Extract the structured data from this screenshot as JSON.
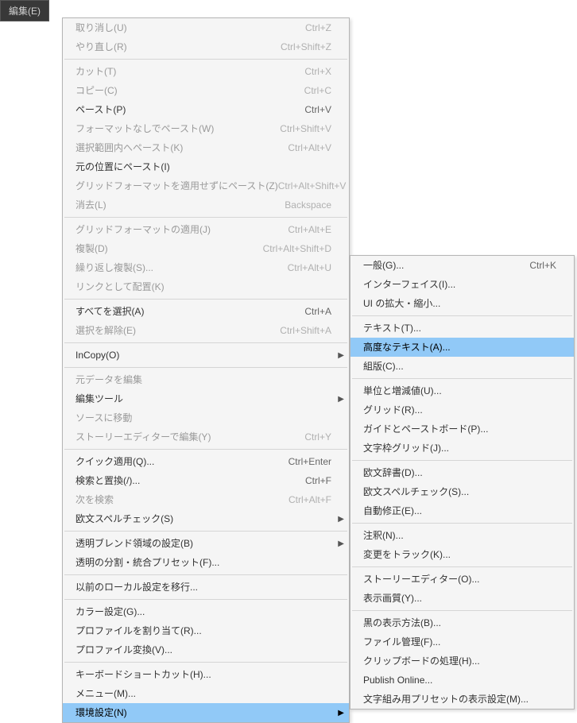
{
  "menu_tab": "編集(E)",
  "main_menu": [
    {
      "label": "取り消し(U)",
      "shortcut": "Ctrl+Z",
      "disabled": true
    },
    {
      "label": "やり直し(R)",
      "shortcut": "Ctrl+Shift+Z",
      "disabled": true
    },
    {
      "sep": true
    },
    {
      "label": "カット(T)",
      "shortcut": "Ctrl+X",
      "disabled": true
    },
    {
      "label": "コピー(C)",
      "shortcut": "Ctrl+C",
      "disabled": true
    },
    {
      "label": "ペースト(P)",
      "shortcut": "Ctrl+V"
    },
    {
      "label": "フォーマットなしでペースト(W)",
      "shortcut": "Ctrl+Shift+V",
      "disabled": true
    },
    {
      "label": "選択範囲内へペースト(K)",
      "shortcut": "Ctrl+Alt+V",
      "disabled": true
    },
    {
      "label": "元の位置にペースト(I)"
    },
    {
      "label": "グリッドフォーマットを適用せずにペースト(Z)",
      "shortcut": "Ctrl+Alt+Shift+V",
      "disabled": true
    },
    {
      "label": "消去(L)",
      "shortcut": "Backspace",
      "disabled": true
    },
    {
      "sep": true
    },
    {
      "label": "グリッドフォーマットの適用(J)",
      "shortcut": "Ctrl+Alt+E",
      "disabled": true
    },
    {
      "label": "複製(D)",
      "shortcut": "Ctrl+Alt+Shift+D",
      "disabled": true
    },
    {
      "label": "繰り返し複製(S)...",
      "shortcut": "Ctrl+Alt+U",
      "disabled": true
    },
    {
      "label": "リンクとして配置(K)",
      "disabled": true
    },
    {
      "sep": true
    },
    {
      "label": "すべてを選択(A)",
      "shortcut": "Ctrl+A"
    },
    {
      "label": "選択を解除(E)",
      "shortcut": "Ctrl+Shift+A",
      "disabled": true
    },
    {
      "sep": true
    },
    {
      "label": "InCopy(O)",
      "submenu": true
    },
    {
      "sep": true
    },
    {
      "label": "元データを編集",
      "disabled": true
    },
    {
      "label": "編集ツール",
      "submenu": true
    },
    {
      "label": "ソースに移動",
      "disabled": true
    },
    {
      "label": "ストーリーエディターで編集(Y)",
      "shortcut": "Ctrl+Y",
      "disabled": true
    },
    {
      "sep": true
    },
    {
      "label": "クイック適用(Q)...",
      "shortcut": "Ctrl+Enter"
    },
    {
      "label": "検索と置換(/)...",
      "shortcut": "Ctrl+F"
    },
    {
      "label": "次を検索",
      "shortcut": "Ctrl+Alt+F",
      "disabled": true
    },
    {
      "label": "欧文スペルチェック(S)",
      "submenu": true
    },
    {
      "sep": true
    },
    {
      "label": "透明ブレンド領域の設定(B)",
      "submenu": true
    },
    {
      "label": "透明の分割・統合プリセット(F)..."
    },
    {
      "sep": true
    },
    {
      "label": "以前のローカル設定を移行..."
    },
    {
      "sep": true
    },
    {
      "label": "カラー設定(G)..."
    },
    {
      "label": "プロファイルを割り当て(R)..."
    },
    {
      "label": "プロファイル変換(V)..."
    },
    {
      "sep": true
    },
    {
      "label": "キーボードショートカット(H)..."
    },
    {
      "label": "メニュー(M)..."
    },
    {
      "label": "環境設定(N)",
      "submenu": true,
      "highlighted": true
    }
  ],
  "sub_menu": [
    {
      "label": "一般(G)...",
      "shortcut": "Ctrl+K"
    },
    {
      "label": "インターフェイス(I)..."
    },
    {
      "label": "UI の拡大・縮小..."
    },
    {
      "sep": true
    },
    {
      "label": "テキスト(T)..."
    },
    {
      "label": "高度なテキスト(A)...",
      "highlighted": true
    },
    {
      "label": "組版(C)..."
    },
    {
      "sep": true
    },
    {
      "label": "単位と増減値(U)..."
    },
    {
      "label": "グリッド(R)..."
    },
    {
      "label": "ガイドとペーストボード(P)..."
    },
    {
      "label": "文字枠グリッド(J)..."
    },
    {
      "sep": true
    },
    {
      "label": "欧文辞書(D)..."
    },
    {
      "label": "欧文スペルチェック(S)..."
    },
    {
      "label": "自動修正(E)..."
    },
    {
      "sep": true
    },
    {
      "label": "注釈(N)..."
    },
    {
      "label": "変更をトラック(K)..."
    },
    {
      "sep": true
    },
    {
      "label": "ストーリーエディター(O)..."
    },
    {
      "label": "表示画質(Y)..."
    },
    {
      "sep": true
    },
    {
      "label": "黒の表示方法(B)..."
    },
    {
      "label": "ファイル管理(F)..."
    },
    {
      "label": "クリップボードの処理(H)..."
    },
    {
      "label": "Publish Online..."
    },
    {
      "label": "文字組み用プリセットの表示設定(M)..."
    }
  ]
}
